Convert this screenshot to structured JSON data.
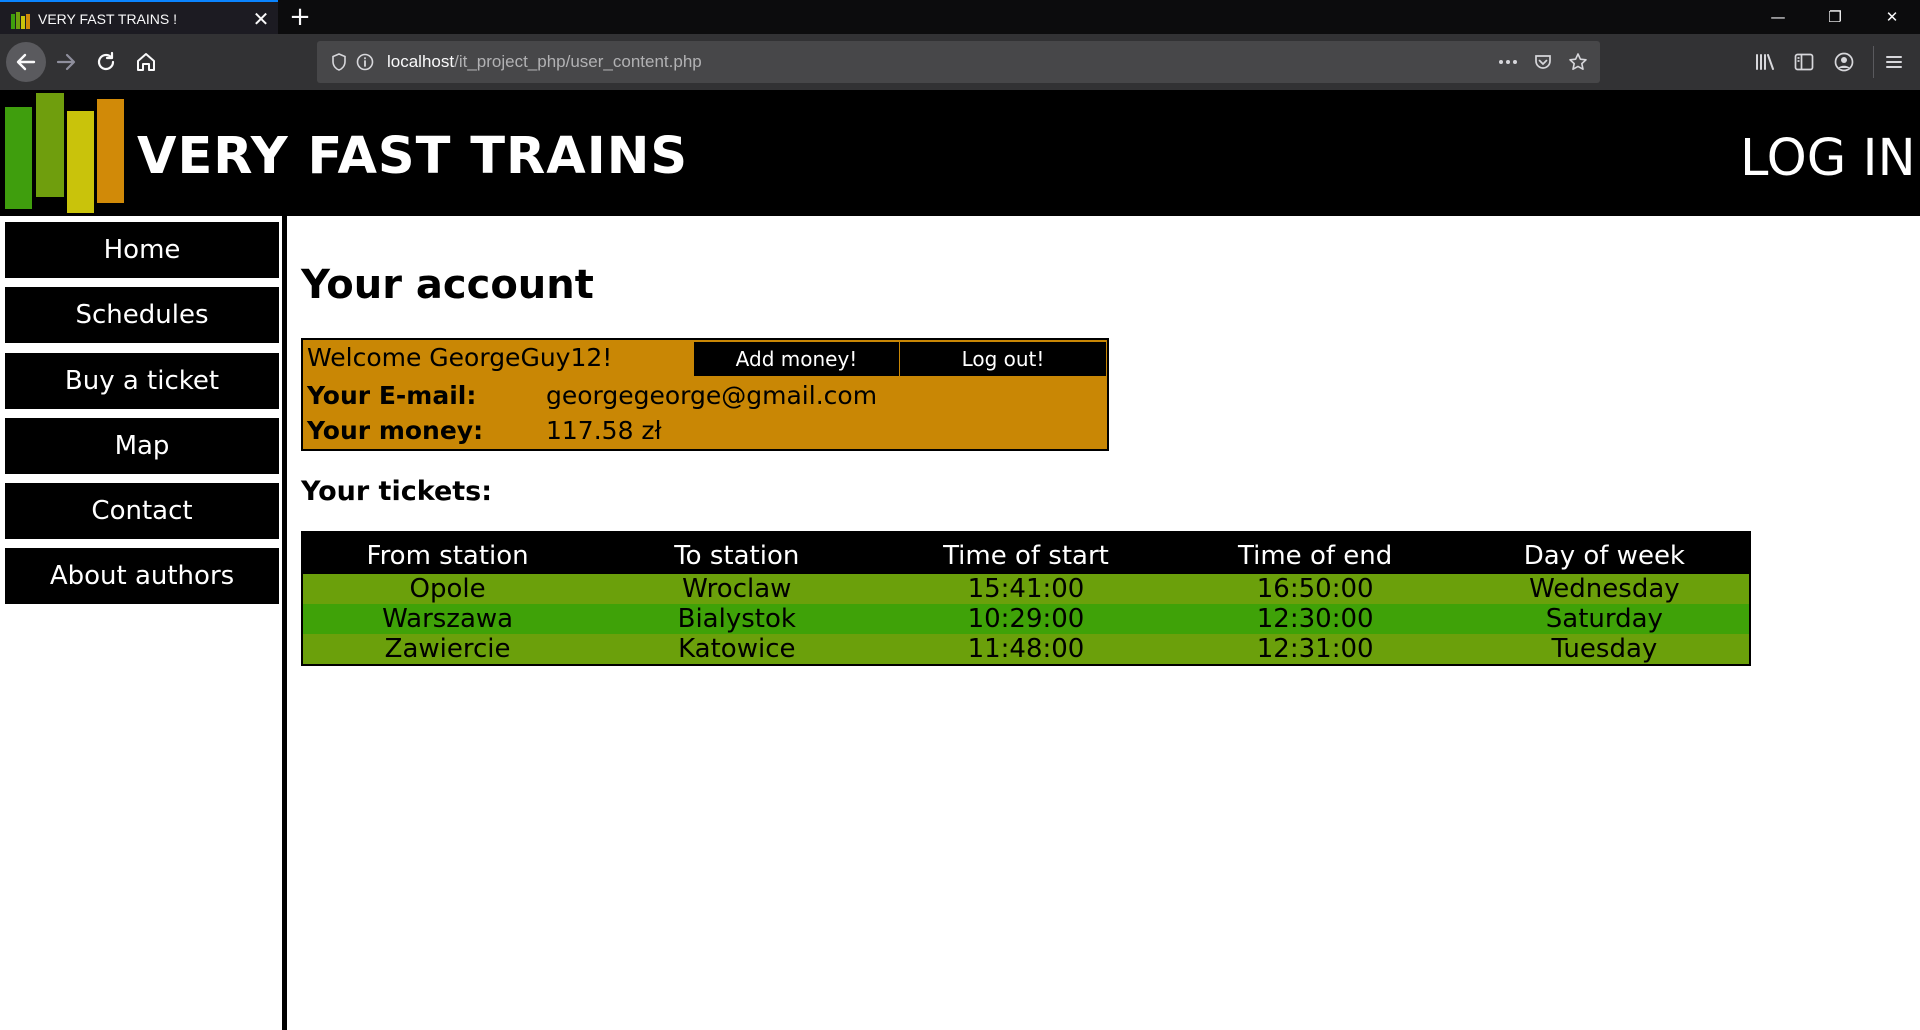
{
  "browser": {
    "tab_title": "VERY FAST TRAINS !",
    "tab_close": "✕",
    "new_tab": "+",
    "url_host": "localhost",
    "url_path": "/it_project_php/user_content.php",
    "window_controls": [
      "—",
      "❐",
      "✕"
    ]
  },
  "header": {
    "title": "VERY FAST TRAINS",
    "login_label": "LOG IN",
    "logo_colors": [
      "#3f9e0d",
      "#6f9e0d",
      "#c9c30b",
      "#d18a08"
    ]
  },
  "sidebar": {
    "items": [
      {
        "label": "Home"
      },
      {
        "label": "Schedules"
      },
      {
        "label": "Buy a ticket"
      },
      {
        "label": "Map"
      },
      {
        "label": "Contact"
      },
      {
        "label": "About authors"
      }
    ]
  },
  "main": {
    "heading": "Your account",
    "account": {
      "welcome": "Welcome GeorgeGuy12!",
      "add_money_label": "Add money!",
      "logout_label": "Log out!",
      "email_label": "Your E-mail:",
      "email_value": "georgegeorge@gmail.com",
      "money_label": "Your money:",
      "money_value": "117.58 zł"
    },
    "tickets_heading": "Your tickets:",
    "tickets_columns": [
      "From station",
      "To station",
      "Time of start",
      "Time of end",
      "Day of week"
    ],
    "tickets_rows": [
      [
        "Opole",
        "Wroclaw",
        "15:41:00",
        "16:50:00",
        "Wednesday"
      ],
      [
        "Warszawa",
        "Bialystok",
        "10:29:00",
        "12:30:00",
        "Saturday"
      ],
      [
        "Zawiercie",
        "Katowice",
        "11:48:00",
        "12:31:00",
        "Tuesday"
      ]
    ]
  },
  "colors": {
    "account_bg": "#c98705",
    "row_odd": "#6ba00b",
    "row_even": "#3fa208"
  }
}
